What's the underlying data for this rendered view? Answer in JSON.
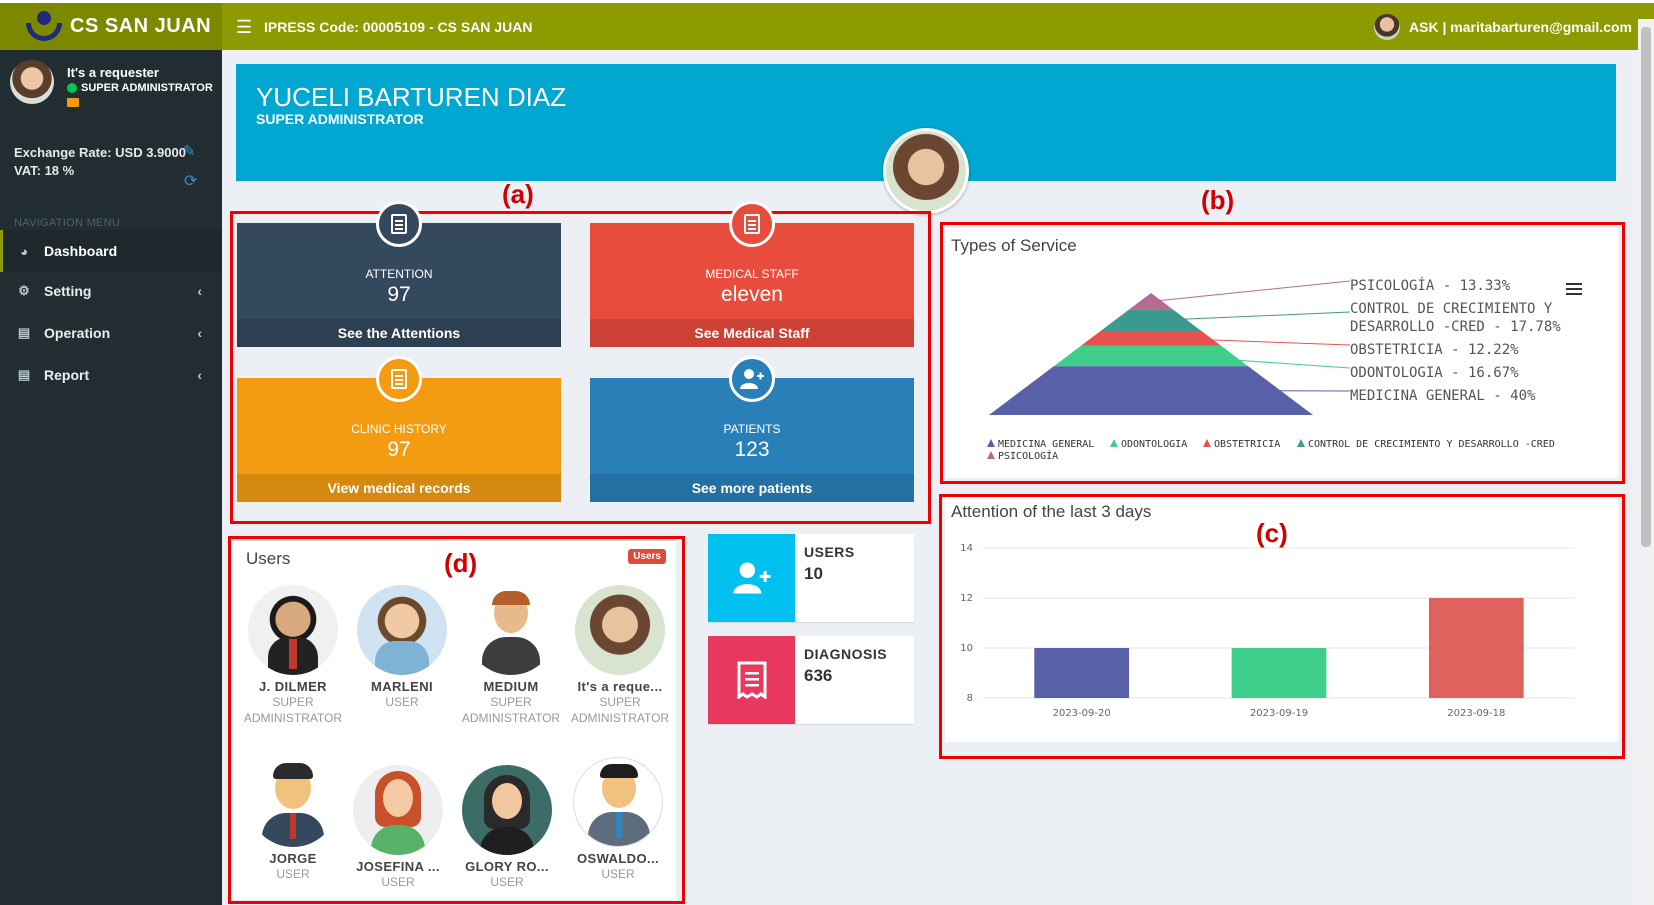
{
  "header": {
    "brand": "CS SAN JUAN",
    "ipress": "IPRESS Code: 00005109 - CS SAN JUAN",
    "user_label": "ASK | maritabarturen@gmail.com"
  },
  "sidebar": {
    "user_name": "It's a requester",
    "user_role": "SUPER ADMINISTRATOR",
    "exchange_rate": "Exchange Rate: USD 3.9000",
    "vat": "VAT: 18 %",
    "nav_header": "NAVIGATION MENU",
    "items": [
      {
        "label": "Dashboard",
        "icon": "dashboard-icon",
        "active": true
      },
      {
        "label": "Setting",
        "icon": "cogs-icon",
        "active": false
      },
      {
        "label": "Operation",
        "icon": "book-icon",
        "active": false
      },
      {
        "label": "Report",
        "icon": "book-icon",
        "active": false
      }
    ]
  },
  "profile": {
    "name": "YUCELI BARTUREN DIAZ",
    "role": "SUPER ADMINISTRATOR"
  },
  "annotations": {
    "a": "(a)",
    "b": "(b)",
    "c": "(c)",
    "d": "(d)"
  },
  "tiles": [
    {
      "label": "ATTENTION",
      "value": "97",
      "footer": "See the Attentions",
      "color": "#34495e",
      "icon": "receipt-icon"
    },
    {
      "label": "MEDICAL STAFF",
      "value": "eleven",
      "footer": "See Medical Staff",
      "color": "#e74c3c",
      "icon": "briefcase-icon"
    },
    {
      "label": "CLINIC HISTORY",
      "value": "97",
      "footer": "View medical records",
      "color": "#f39c12",
      "icon": "clipboard-icon"
    },
    {
      "label": "PATIENTS",
      "value": "123",
      "footer": "See more patients",
      "color": "#2980b9",
      "icon": "user-plus-icon"
    }
  ],
  "users_panel": {
    "title": "Users",
    "badge": "Users",
    "users": [
      {
        "name": "J. DILMER",
        "role": "SUPER ADMINISTRATOR"
      },
      {
        "name": "MARLENI",
        "role": "USER"
      },
      {
        "name": "MEDIUM",
        "role": "SUPER ADMINISTRATOR"
      },
      {
        "name": "It's a reque...",
        "role": "SUPER ADMINISTRATOR"
      },
      {
        "name": "JORGE",
        "role": "USER"
      },
      {
        "name": "JOSEFINA ...",
        "role": "USER"
      },
      {
        "name": "GLORY RO...",
        "role": "USER"
      },
      {
        "name": "OSWALDO...",
        "role": "USER"
      }
    ]
  },
  "info_boxes": [
    {
      "label": "USERS",
      "value": "10",
      "color": "#00c0ef",
      "icon": "user-plus-icon"
    },
    {
      "label": "DIAGNOSIS",
      "value": "636",
      "color": "#e8385e",
      "icon": "receipt-icon"
    }
  ],
  "chart_data": [
    {
      "type": "pyramid",
      "title": "Types of Service",
      "categories": [
        "PSICOLOGÍA",
        "CONTROL DE CRECIMIENTO Y DESARROLLO -CRED",
        "OBSTETRICIA",
        "ODONTOLOGIA",
        "MEDICINA GENERAL"
      ],
      "values": [
        13.33,
        17.78,
        12.22,
        16.67,
        40
      ],
      "unit": "%",
      "colors": [
        "#b56b8f",
        "#3a9a8f",
        "#e8514d",
        "#3fcf8a",
        "#5861a8"
      ],
      "data_labels": [
        "PSICOLOGÍA - 13.33%",
        "CONTROL DE CRECIMIENTO Y DESARROLLO -CRED - 17.78%",
        "OBSTETRICIA - 12.22%",
        "ODONTOLOGIA - 16.67%",
        "MEDICINA GENERAL - 40%"
      ],
      "legend": [
        "MEDICINA GENERAL",
        "ODONTOLOGIA",
        "OBSTETRICIA",
        "CONTROL DE CRECIMIENTO Y DESARROLLO -CRED",
        "PSICOLOGÍA"
      ],
      "legend_position": "bottom"
    },
    {
      "type": "bar",
      "title": "Attention of the last 3 days",
      "categories": [
        "2023-09-20",
        "2023-09-19",
        "2023-09-18"
      ],
      "values": [
        10,
        10,
        12
      ],
      "colors": [
        "#5861a8",
        "#3fcf8a",
        "#e0625c"
      ],
      "ylim": [
        8,
        14
      ],
      "yticks": [
        "14",
        "12",
        "10",
        "8"
      ],
      "grid": true
    }
  ]
}
